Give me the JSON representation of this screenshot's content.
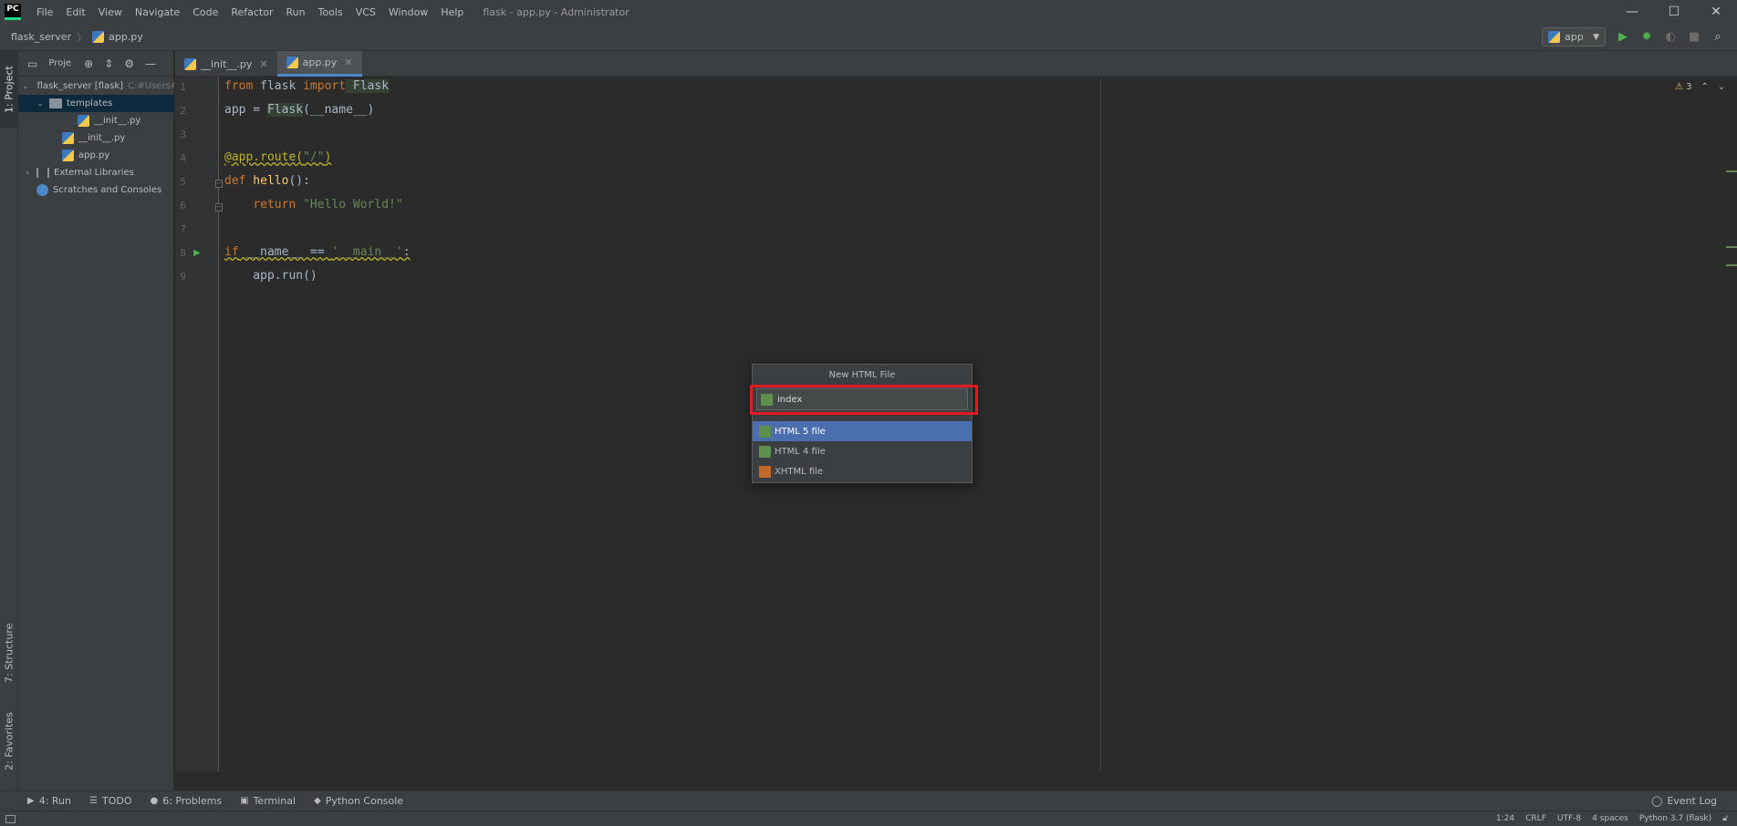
{
  "app": {
    "logo": "PC",
    "window_title": "flask - app.py - Administrator"
  },
  "menu": [
    "File",
    "Edit",
    "View",
    "Navigate",
    "Code",
    "Refactor",
    "Run",
    "Tools",
    "VCS",
    "Window",
    "Help"
  ],
  "window_controls": {
    "minimize": "—",
    "maximize": "☐",
    "close": "✕"
  },
  "breadcrumb": {
    "project": "flask_server",
    "file": "app.py"
  },
  "run_config": {
    "label": "app"
  },
  "left_strip": {
    "project_tab": "1: Project",
    "structure_tab": "7: Structure",
    "favorites_tab": "2: Favorites"
  },
  "project_panel": {
    "view_label": "Proje",
    "tree": [
      {
        "label": "flask_server [flask]",
        "muted": "C:#Users#"
      },
      {
        "label": "templates"
      },
      {
        "label": "__init__.py"
      },
      {
        "label": "__init__.py"
      },
      {
        "label": "app.py"
      },
      {
        "label": "External Libraries"
      },
      {
        "label": "Scratches and Consoles"
      }
    ]
  },
  "editor_tabs": [
    {
      "label": "__init__.py",
      "active": false
    },
    {
      "label": "app.py",
      "active": true
    }
  ],
  "editor": {
    "line_numbers": [
      "1",
      "2",
      "3",
      "4",
      "5",
      "6",
      "7",
      "8",
      "9"
    ],
    "lines": {
      "l1": {
        "kw1": "from",
        "mod": " flask ",
        "kw2": "import",
        "cls": " Flask"
      },
      "l2": {
        "pre": "app = ",
        "cls": "Flask",
        "post": "(__name__)"
      },
      "l4": {
        "dec": "@app.route(",
        "str": "\"/\"",
        "close": ")"
      },
      "l5": {
        "kw": "def",
        "fn": " hello",
        "post": "():"
      },
      "l6": {
        "indent": "    ",
        "kw": "return",
        "str": " \"Hello World!\""
      },
      "l8": {
        "kw": "if",
        "mid": " __name__ == ",
        "str": "'__main__'",
        "post": ":"
      },
      "l9": {
        "text": "    app.run()"
      }
    },
    "inspection_count": "3"
  },
  "popup": {
    "title": "New HTML File",
    "input_value": "index",
    "options": [
      {
        "label": "HTML 5 file",
        "selected": true
      },
      {
        "label": "HTML 4 file",
        "selected": false
      },
      {
        "label": "XHTML file",
        "selected": false
      }
    ],
    "highlight_color": "#e21b23"
  },
  "bottom_tabs": [
    {
      "label": "4: Run",
      "icon": "▶"
    },
    {
      "label": "TODO",
      "icon": "☰"
    },
    {
      "label": "6: Problems",
      "icon": "●"
    },
    {
      "label": "Terminal",
      "icon": "▣"
    },
    {
      "label": "Python Console",
      "icon": "◆"
    }
  ],
  "event_log": "Event Log",
  "status": {
    "position": "1:24",
    "line_sep": "CRLF",
    "encoding": "UTF-8",
    "indent": "4 spaces",
    "interpreter": "Python 3.7 (flask)"
  },
  "colors": {
    "accent": "#4b6eaf",
    "keyword": "#cc7832",
    "string": "#6a8759",
    "function": "#ffc66d",
    "decorator": "#bbb529"
  }
}
